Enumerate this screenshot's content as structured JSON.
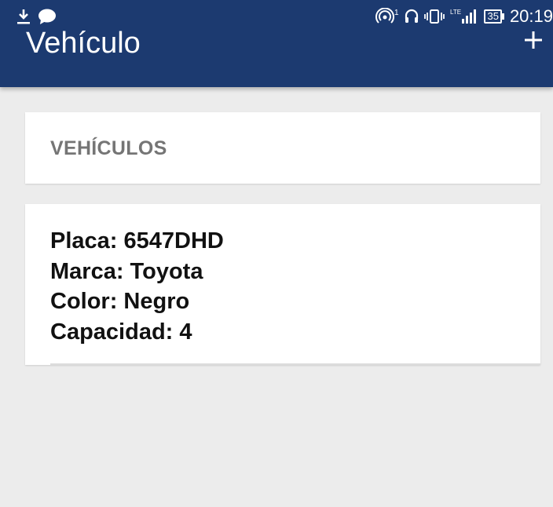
{
  "status_bar": {
    "time": "20:19",
    "battery": "35",
    "network": "LTE",
    "left_icons": [
      "download-icon",
      "chat-bubble-icon"
    ],
    "right_icons": [
      "hotspot-icon",
      "headset-icon",
      "vibrate-icon",
      "lte-signal-icon",
      "battery-icon"
    ]
  },
  "app_bar": {
    "title": "Vehículo",
    "action_icon": "plus-icon"
  },
  "section": {
    "title": "VEHÍCULOS"
  },
  "vehicles": [
    {
      "placa": "Placa: 6547DHD",
      "marca": "Marca: Toyota",
      "color": "Color: Negro",
      "capacidad": "Capacidad: 4"
    }
  ],
  "colors": {
    "app_bar": "#1c3a70",
    "background": "#ececec",
    "section_title": "#757575"
  }
}
